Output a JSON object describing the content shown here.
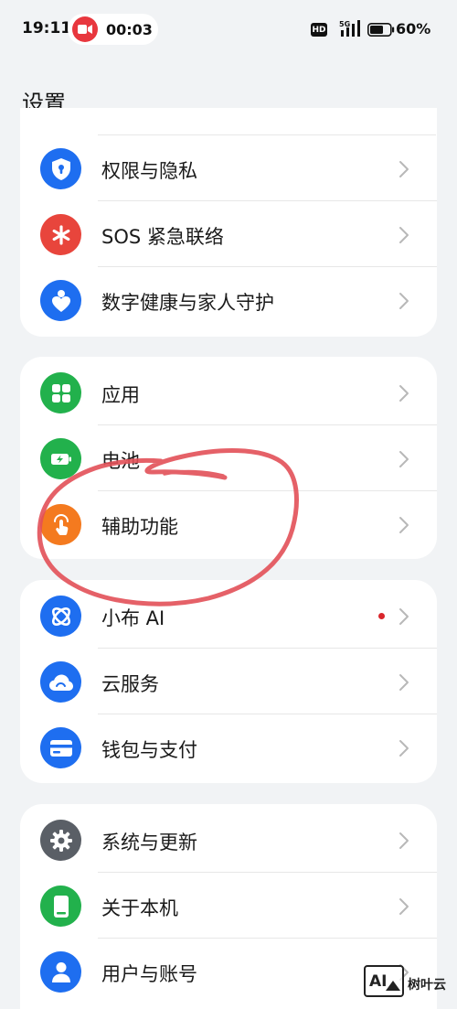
{
  "status_bar": {
    "time": "19:11",
    "recording_time": "00:03",
    "hd_badge": "HD",
    "network": "5G",
    "battery": "60%"
  },
  "page": {
    "title": "设置"
  },
  "groups": [
    {
      "items": [
        {
          "label": "权限与隐私",
          "icon": "shield-keyhole-icon",
          "icon_color": "#1e6ef0"
        },
        {
          "label": "SOS 紧急联络",
          "icon": "asterisk-icon",
          "icon_color": "#e8453c"
        },
        {
          "label": "数字健康与家人守护",
          "icon": "heart-person-icon",
          "icon_color": "#1e6ef0"
        }
      ]
    },
    {
      "items": [
        {
          "label": "应用",
          "icon": "app-grid-icon",
          "icon_color": "#22b14c"
        },
        {
          "label": "电池",
          "icon": "battery-charging-icon",
          "icon_color": "#22b14c"
        },
        {
          "label": "辅助功能",
          "icon": "touch-hand-icon",
          "icon_color": "#f47a1f"
        }
      ]
    },
    {
      "items": [
        {
          "label": "小布 AI",
          "icon": "xiaobu-ai-icon",
          "icon_color": "#1e6ef0",
          "badge_color": "#d9262c"
        },
        {
          "label": "云服务",
          "icon": "cloud-icon",
          "icon_color": "#1e6ef0"
        },
        {
          "label": "钱包与支付",
          "icon": "wallet-card-icon",
          "icon_color": "#1e6ef0"
        }
      ]
    },
    {
      "items": [
        {
          "label": "系统与更新",
          "icon": "gear-icon",
          "icon_color": "#5a5f66"
        },
        {
          "label": "关于本机",
          "icon": "phone-icon",
          "icon_color": "#22b14c"
        },
        {
          "label": "用户与账号",
          "icon": "user-icon",
          "icon_color": "#1e6ef0"
        }
      ]
    }
  ],
  "annotation": {
    "color": "#e25058"
  },
  "watermark": {
    "logo_text": "AI",
    "text": "树叶云"
  }
}
